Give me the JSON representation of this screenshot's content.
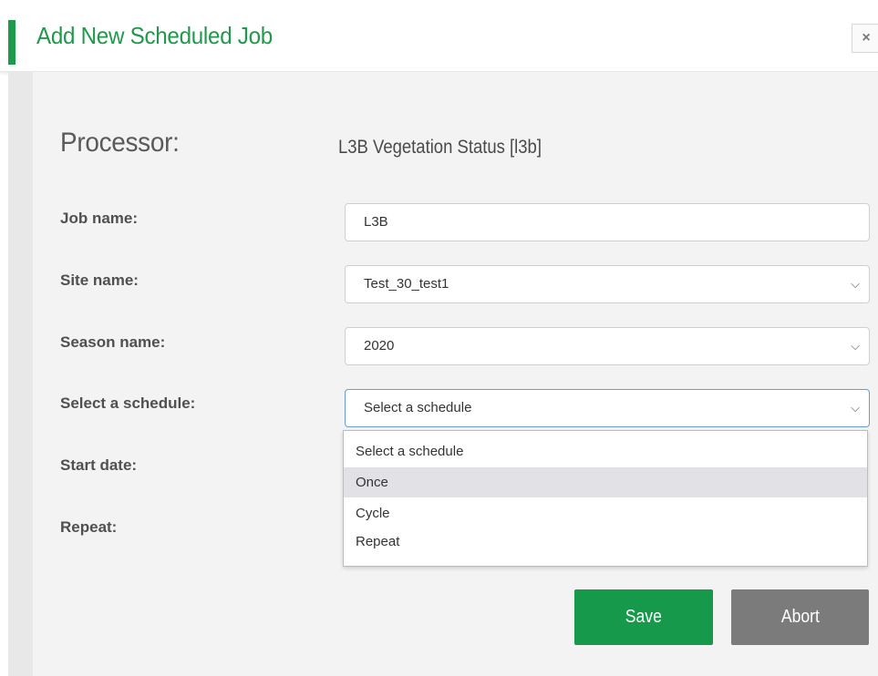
{
  "dialog": {
    "title": "Add New Scheduled Job",
    "close_icon": "close-icon",
    "close_glyph": "×",
    "accent_color": "#1f9a4b"
  },
  "processor": {
    "label": "Processor:",
    "value": "L3B Vegetation Status [l3b]"
  },
  "fields": {
    "job_name": {
      "label": "Job name:",
      "value": "L3B"
    },
    "site_name": {
      "label": "Site name:",
      "value": "Test_30_test1"
    },
    "season_name": {
      "label": "Season name:",
      "value": "2020"
    },
    "schedule": {
      "label": "Select a schedule:",
      "value": "Select a schedule",
      "options": [
        "Select a schedule",
        "Once",
        "Cycle",
        "Repeat"
      ],
      "highlighted": "Once"
    },
    "start_date": {
      "label": "Start date:"
    },
    "repeat": {
      "label": "Repeat:"
    }
  },
  "icons": {
    "chevron": "chevron-down-icon",
    "chevron_glyph": "⌵"
  },
  "buttons": {
    "save": "Save",
    "abort": "Abort",
    "save_color": "#16994a",
    "abort_color": "#7b7b7b"
  }
}
